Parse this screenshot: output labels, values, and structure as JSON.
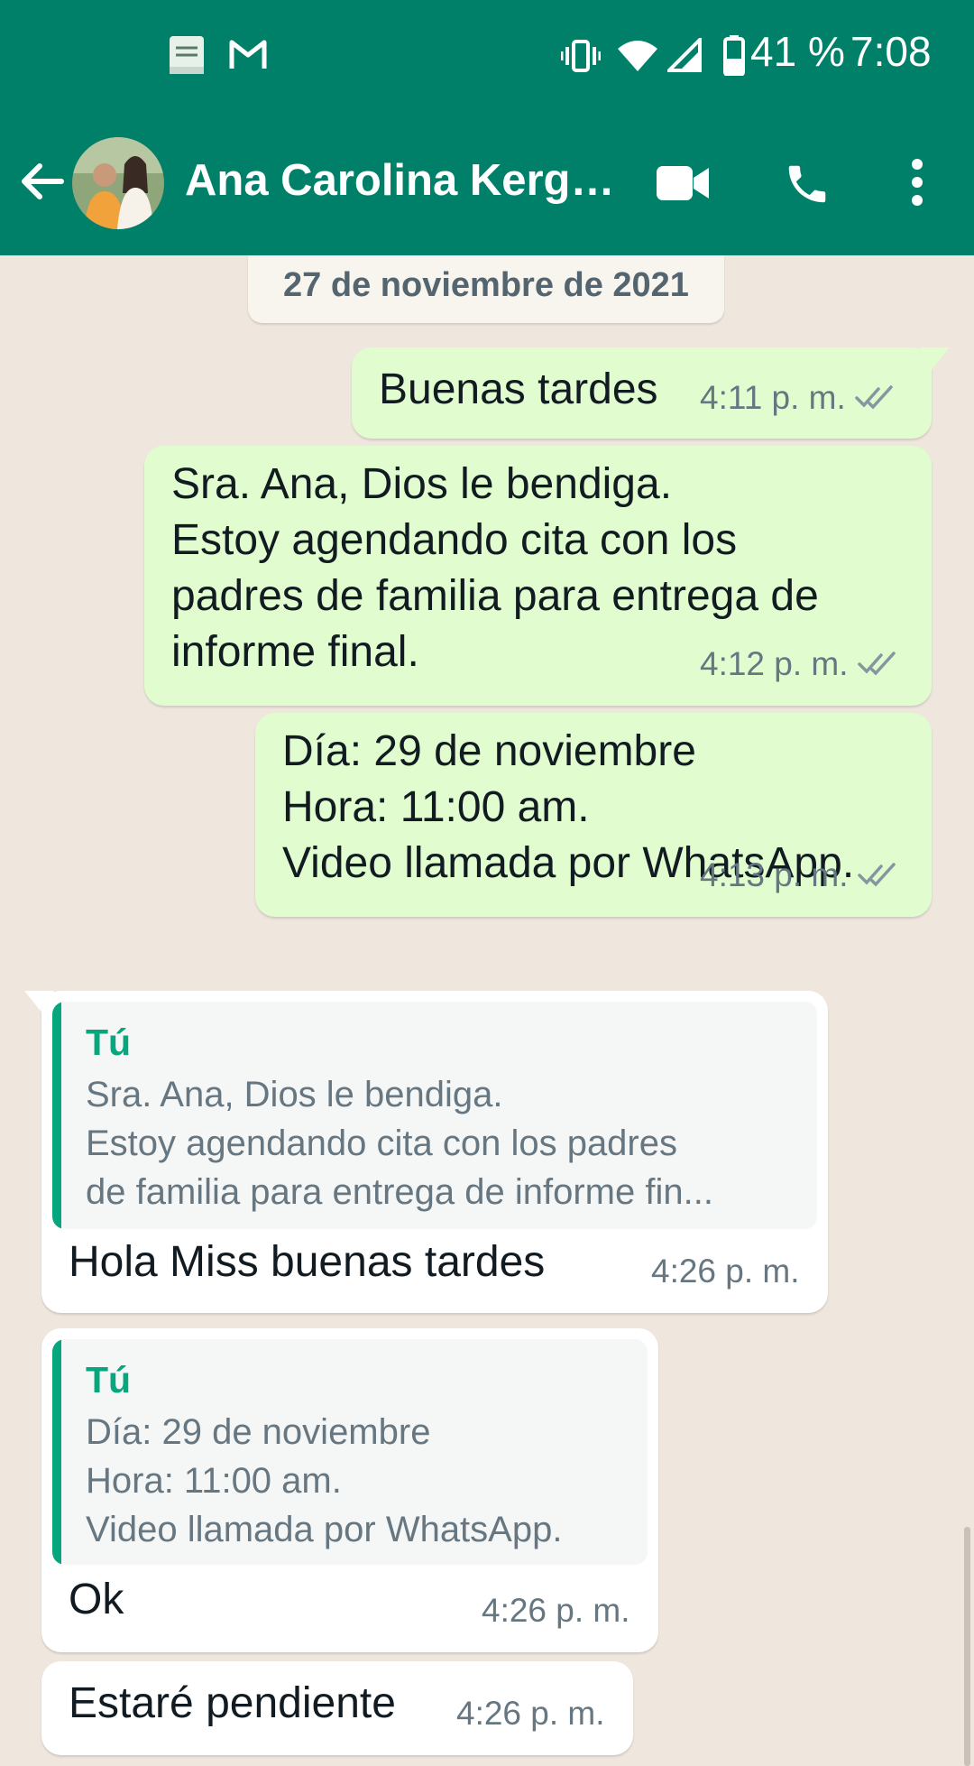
{
  "status_bar": {
    "battery": "41 %",
    "time": "7:08",
    "notification_icons": [
      "holy-bible-app-icon",
      "gmail-icon"
    ],
    "system_icons": [
      "vibrate-icon",
      "wifi-icon",
      "signal-icon",
      "battery-icon"
    ]
  },
  "header": {
    "contact_name": "Ana Carolina Kergu...",
    "actions": [
      "video-call-icon",
      "voice-call-icon",
      "more-options-icon"
    ]
  },
  "chat": {
    "date_chip": "27 de noviembre de 2021",
    "messages": [
      {
        "direction": "outgoing",
        "text": "Buenas tardes",
        "time": "4:11 p. m.",
        "status": "read"
      },
      {
        "direction": "outgoing",
        "text": "Sra. Ana, Dios le bendiga.\nEstoy agendando cita con los\npadres de familia para entrega de\ninforme final.",
        "time": "4:12 p. m.",
        "status": "read"
      },
      {
        "direction": "outgoing",
        "text": "Día: 29 de noviembre\nHora: 11:00 am.\nVideo llamada por WhatsApp.",
        "time": "4:13 p. m.",
        "status": "read"
      },
      {
        "direction": "incoming",
        "quote_author": "Tú",
        "quote_text": "Sra. Ana, Dios le bendiga.\nEstoy agendando cita con los padres\nde familia para entrega de informe fin...",
        "text": "Hola Miss buenas tardes",
        "time": "4:26 p. m."
      },
      {
        "direction": "incoming",
        "quote_author": "Tú",
        "quote_text": "Día: 29 de noviembre\nHora: 11:00 am.\nVideo llamada por WhatsApp.",
        "text": "Ok",
        "time": "4:26 p. m."
      },
      {
        "direction": "incoming",
        "text": "Estaré pendiente",
        "time": "4:26 p. m."
      }
    ]
  },
  "colors": {
    "header_green": "#008069",
    "outgoing_bubble": "#e1fdcf",
    "incoming_bubble": "#ffffff",
    "chat_background": "#efe7de",
    "quote_accent": "#06a77d",
    "read_ticks": "#8696a0"
  }
}
